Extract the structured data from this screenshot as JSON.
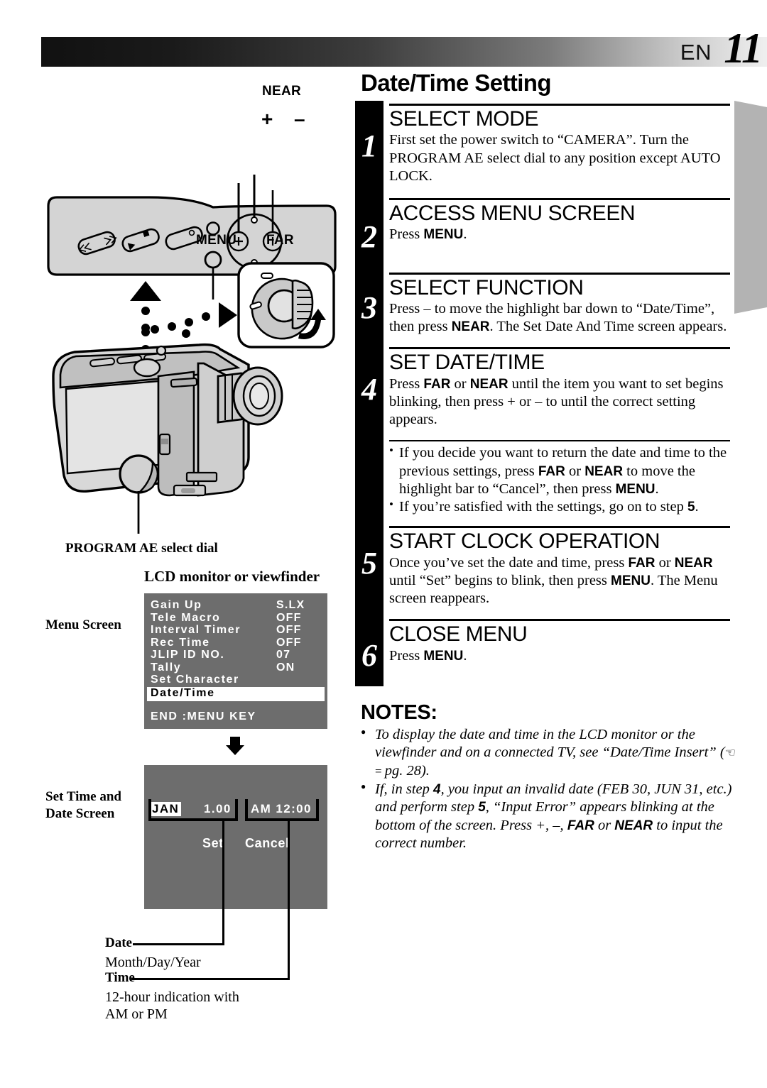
{
  "header": {
    "lang": "EN",
    "page_number": "11"
  },
  "title": "Date/Time Setting",
  "steps": [
    {
      "num": "1",
      "heading": "SELECT MODE",
      "body": "First set the power switch to “CAMERA”. Turn the PROGRAM AE select dial to any position except AUTO LOCK."
    },
    {
      "num": "2",
      "heading": "ACCESS MENU SCREEN",
      "body_pre": "Press ",
      "body_bold": "MENU",
      "body_post": "."
    },
    {
      "num": "3",
      "heading": "SELECT FUNCTION",
      "body_a": "Press – to move the highlight bar down to “Date/Time”, then press ",
      "body_b": "NEAR",
      "body_c": ". The Set Date And Time screen appears."
    },
    {
      "num": "4",
      "heading": "SET DATE/TIME",
      "body_a": "Press ",
      "body_b": "FAR",
      "body_c": " or ",
      "body_d": "NEAR",
      "body_e": " until the item you want to set begins blinking, then press + or – to until the correct setting appears."
    },
    {
      "num": "5",
      "heading": "START CLOCK OPERATION",
      "body_a": "Once you’ve set the date and time, press ",
      "body_b": "FAR",
      "body_c": " or ",
      "body_d": "NEAR",
      "body_e": " until “Set” begins to blink, then press ",
      "body_f": "MENU",
      "body_g": ". The Menu screen reappears."
    },
    {
      "num": "6",
      "heading": "CLOSE MENU",
      "body_pre": "Press ",
      "body_bold": "MENU",
      "body_post": "."
    }
  ],
  "step4_bullets": [
    {
      "a": "If you decide you want to return the date and time to the previous settings, press ",
      "b": "FAR",
      "c": " or ",
      "d": "NEAR",
      "e": " to move the highlight bar to “Cancel”, then press ",
      "f": "MENU",
      "g": "."
    },
    {
      "a": "If you’re satisfied with the settings, go on to step ",
      "b": "5",
      "c": "."
    }
  ],
  "notes": {
    "title": "NOTES:",
    "items": [
      {
        "a": "To display the date and time in the LCD monitor or the viewfinder and on a connected TV, see “Date/Time Insert” (",
        "b": " pg. 28)."
      },
      {
        "a": "If, in step ",
        "b": "4",
        "c": ", you input an invalid date (FEB 30, JUN 31, etc.) and perform step ",
        "d": "5",
        "e": ", “Input Error” appears blinking at the bottom of the screen. Press +, –, ",
        "f": "FAR",
        "g": " or ",
        "h": "NEAR",
        "i": " to input the correct number."
      }
    ]
  },
  "illustration": {
    "near_label": "NEAR",
    "plus_label": "+",
    "minus_label": "–",
    "menu_label": "MENU",
    "far_label": "FAR",
    "program_ae_label": "PROGRAM AE select dial",
    "lcd_caption": "LCD monitor or viewfinder",
    "menu_screen_caption": "Menu Screen",
    "set_time_caption_l1": "Set Time and",
    "set_time_caption_l2": "Date Screen",
    "date_label": "Date",
    "date_desc": "Month/Day/Year",
    "time_label": "Time",
    "time_desc_l1": "12-hour indication with",
    "time_desc_l2": "AM or PM"
  },
  "menu_screen": {
    "rows": [
      {
        "label": "Gain Up",
        "value": "S.LX"
      },
      {
        "label": "Tele Macro",
        "value": "OFF"
      },
      {
        "label": "Interval Timer",
        "value": "OFF"
      },
      {
        "label": "Rec Time",
        "value": "OFF"
      },
      {
        "label": "JLIP ID NO.",
        "value": "07"
      },
      {
        "label": "Tally",
        "value": "ON"
      },
      {
        "label": "Set Character",
        "value": ""
      }
    ],
    "selected_row": "Date/Time",
    "footer": "END :MENU KEY"
  },
  "date_screen": {
    "month": "JAN",
    "day_year": "1.00",
    "time": "AM 12:00",
    "set_label": "Set",
    "cancel_label": "Cancel"
  },
  "colors": {
    "osd_background": "#6d6d6d",
    "osd_text": "#ffffff",
    "highlight_background": "#ffffff",
    "highlight_text": "#000000",
    "step_column": "#000000",
    "edge_tab": "#b3b3b3"
  }
}
